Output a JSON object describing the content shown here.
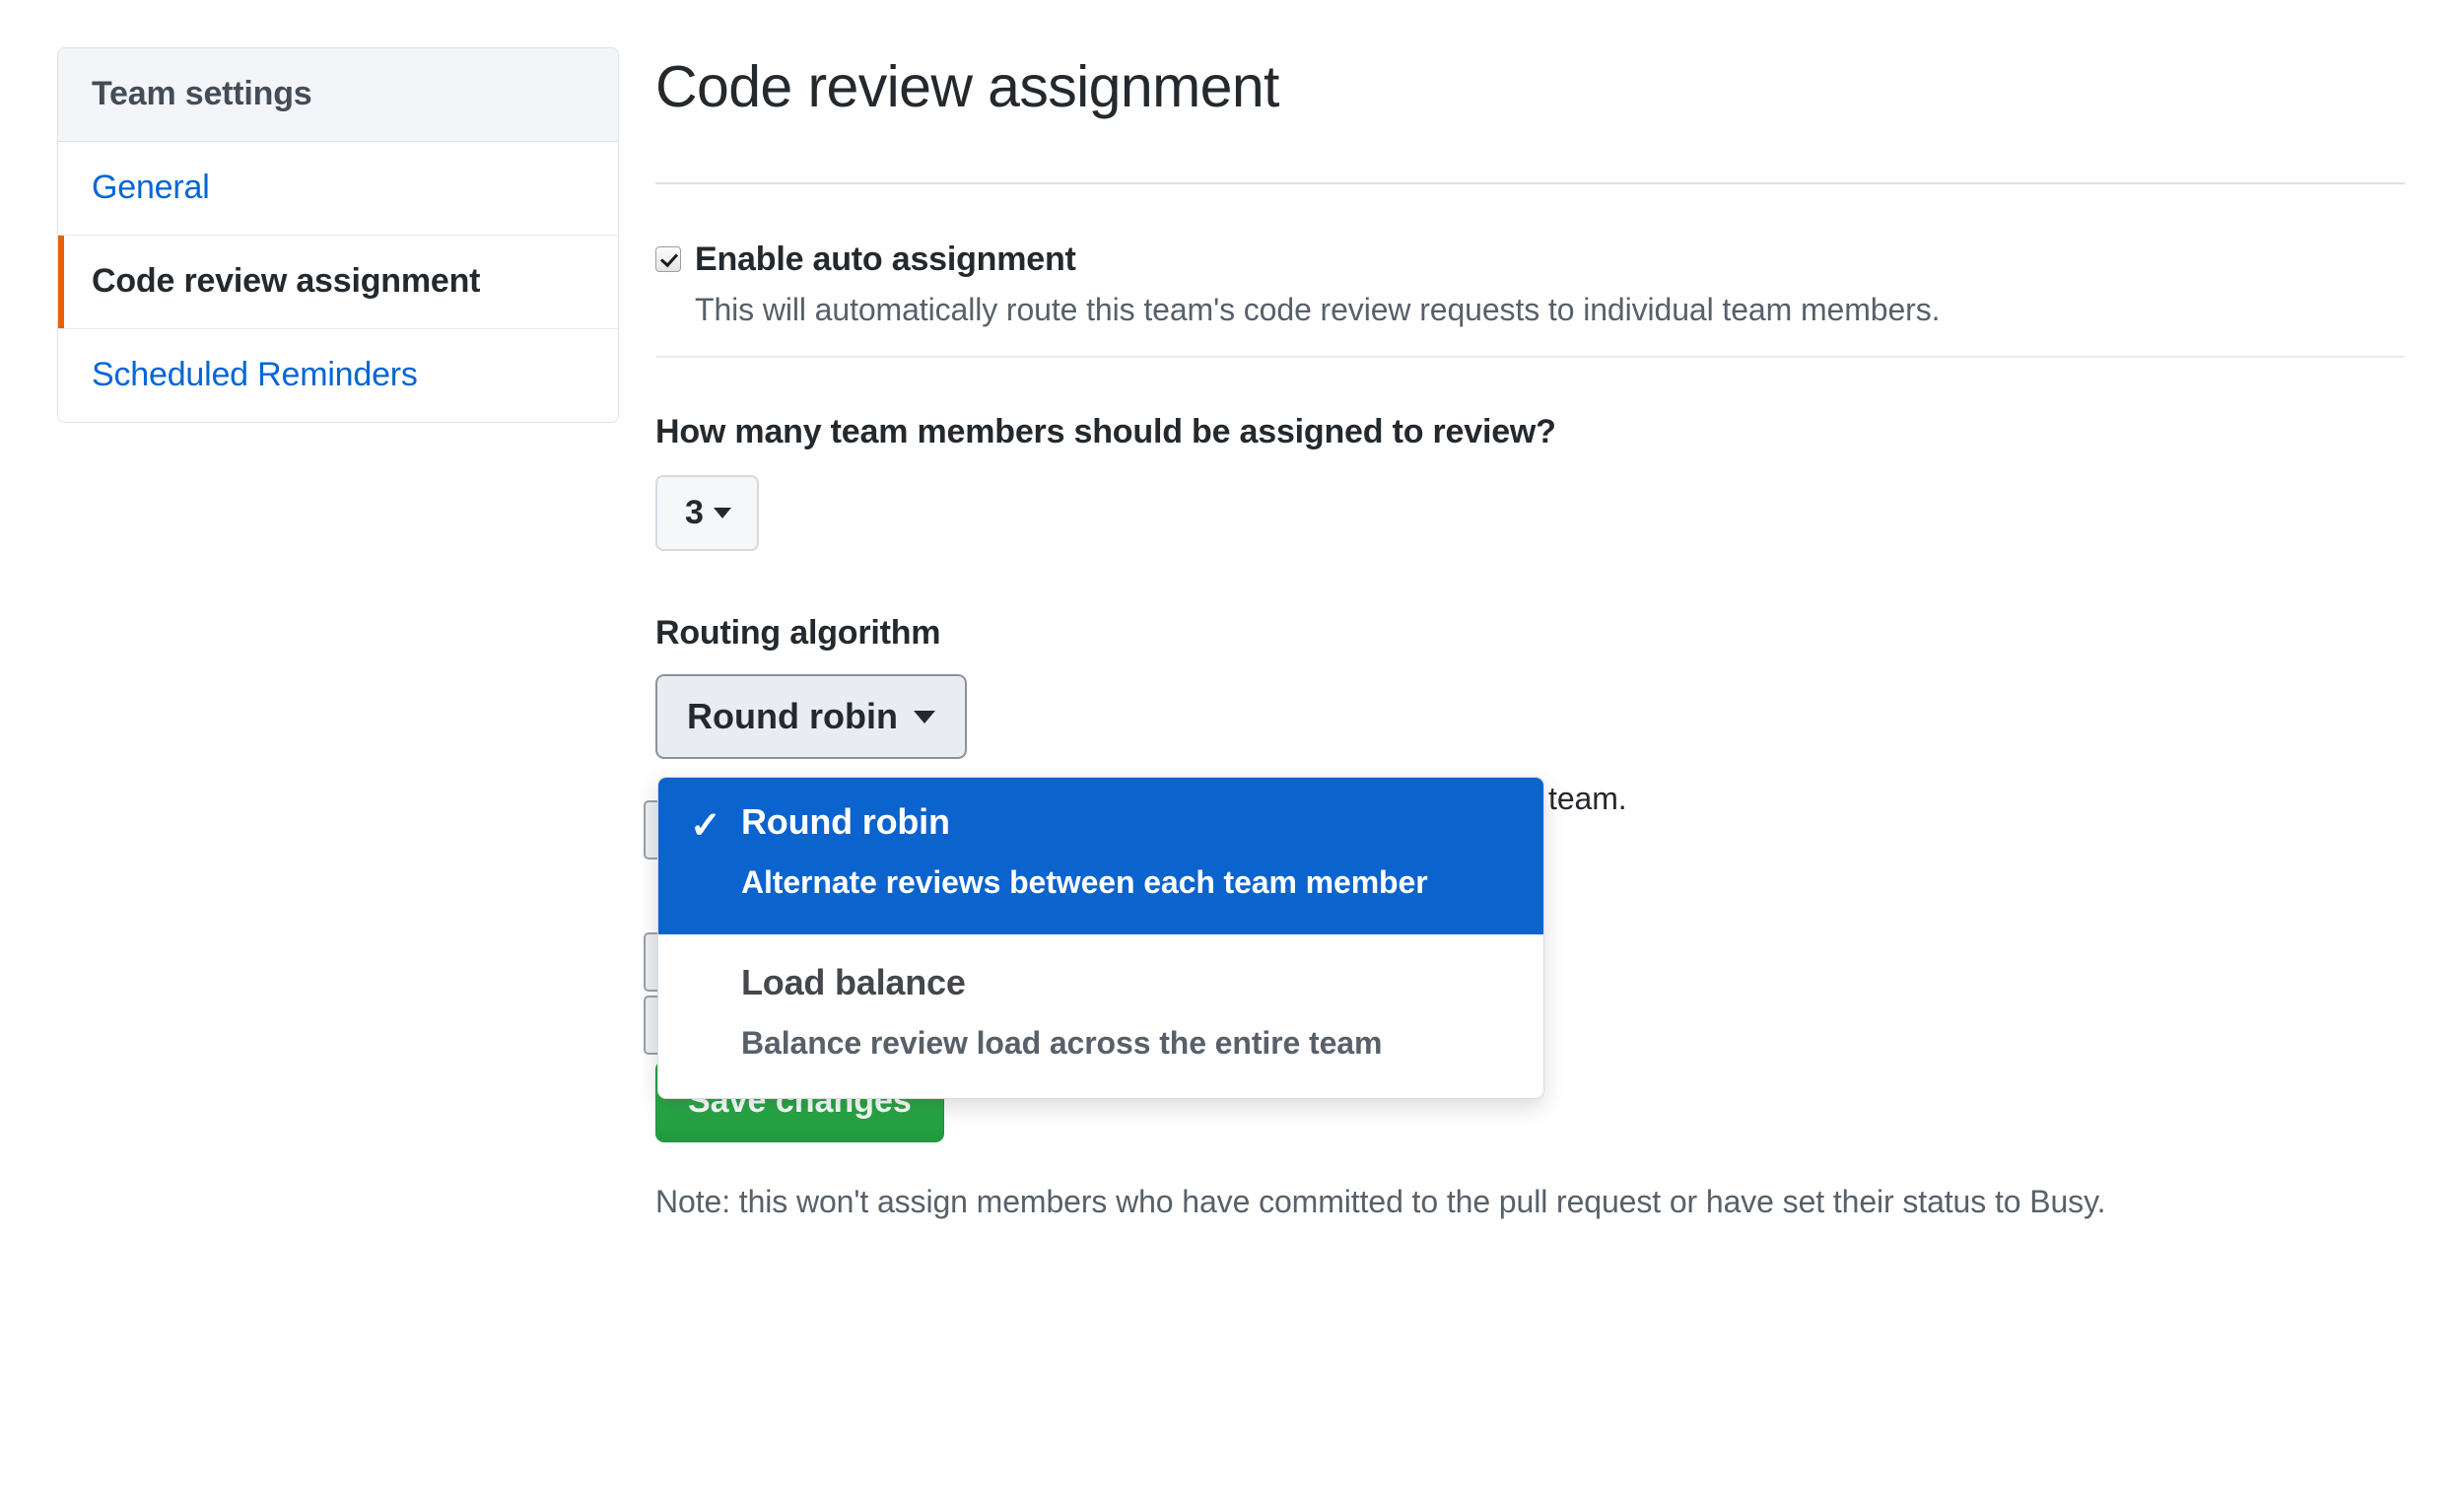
{
  "sidebar": {
    "header": "Team settings",
    "items": [
      {
        "label": "General",
        "selected": false
      },
      {
        "label": "Code review assignment",
        "selected": true
      },
      {
        "label": "Scheduled Reminders",
        "selected": false
      }
    ]
  },
  "main": {
    "title": "Code review assignment",
    "auto_assignment": {
      "label": "Enable auto assignment",
      "checked": true,
      "description": "This will automatically route this team's code review requests to individual team members."
    },
    "member_count": {
      "question": "How many team members should be assigned to review?",
      "value": "3"
    },
    "routing": {
      "label": "Routing algorithm",
      "selected_value": "Round robin",
      "description_tail": "ire team.",
      "options": [
        {
          "title": "Round robin",
          "description": "Alternate reviews between each team member",
          "selected": true
        },
        {
          "title": "Load balance",
          "description": "Balance review load across the entire team",
          "selected": false
        }
      ]
    },
    "save_label": "Save changes",
    "note": "Note: this won't assign members who have committed to the pull request or have set their status to Busy."
  },
  "colors": {
    "accent_blue": "#0366d6",
    "selected_orange": "#e36209",
    "dropdown_active": "#0b63ce",
    "save_green": "#28a745"
  },
  "icons": {
    "caret_down": "caret-down-icon",
    "check": "check-icon",
    "checkmark": "✓"
  }
}
